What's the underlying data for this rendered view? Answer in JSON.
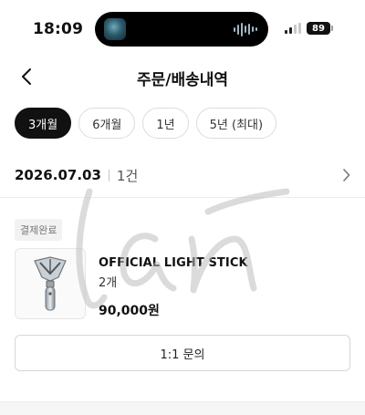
{
  "status_bar": {
    "time": "18:09",
    "battery_level": "89"
  },
  "header": {
    "title": "주문/배송내역",
    "back_icon": "chevron-left-icon"
  },
  "filters": [
    {
      "label": "3개월",
      "active": true
    },
    {
      "label": "6개월",
      "active": false
    },
    {
      "label": "1년",
      "active": false
    },
    {
      "label": "5년 (최대)",
      "active": false
    }
  ],
  "order": {
    "date": "2026.07.03",
    "count": "1건",
    "status": "결제완료",
    "item": {
      "name": "OFFICIAL LIGHT STICK",
      "quantity": "2개",
      "price": "90,000원",
      "thumbnail_icon": "light-stick-icon"
    },
    "inquiry_label": "1:1 문의"
  },
  "watermark_text": "Lan",
  "colors": {
    "active_chip": "#111111",
    "text": "#111111",
    "muted": "#777777"
  }
}
